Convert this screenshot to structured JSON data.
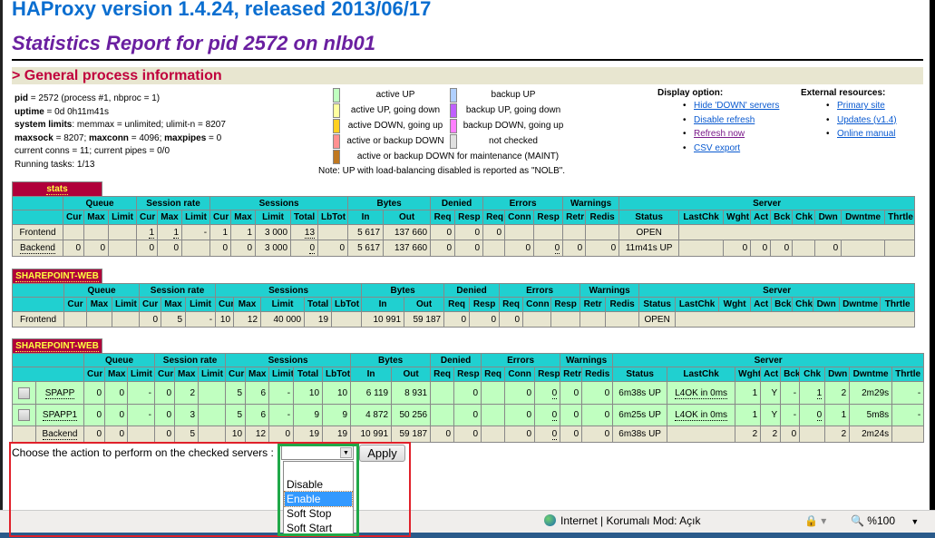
{
  "header": {
    "version_title": "HAProxy version 1.4.24, released 2013/06/17",
    "report_title": "Statistics Report for pid 2572 on nlb01",
    "section_title": "> General process information"
  },
  "process_info": {
    "pid_label": "pid",
    "pid_value": " = 2572 (process #1, nbproc = 1)",
    "uptime_label": "uptime",
    "uptime_value": " = 0d 0h11m41s",
    "limits_label": "system limits",
    "limits_value": ": memmax = unlimited; ulimit-n = 8207",
    "maxsock_label": "maxsock",
    "maxsock_value": " = 8207; ",
    "maxconn_label": "maxconn",
    "maxconn_value": " = 4096; ",
    "maxpipes_label": "maxpipes",
    "maxpipes_value": " = 0",
    "conns": "current conns = 11; current pipes = 0/0",
    "tasks": "Running tasks: 1/13"
  },
  "legend": {
    "items": [
      {
        "label": "active UP",
        "color": "#c0ffc0"
      },
      {
        "label": "backup UP",
        "color": "#b0d0ff"
      },
      {
        "label": "active UP, going down",
        "color": "#ffffa0"
      },
      {
        "label": "backup UP, going down",
        "color": "#c060ff"
      },
      {
        "label": "active DOWN, going up",
        "color": "#ffd020"
      },
      {
        "label": "backup DOWN, going up",
        "color": "#ff80ff"
      },
      {
        "label": "active or backup DOWN",
        "color": "#ff9090"
      },
      {
        "label": "not checked",
        "color": "#e0e0e0"
      },
      {
        "label": "active or backup DOWN for maintenance (MAINT)",
        "color": "#c07820"
      }
    ],
    "note": "Note: UP with load-balancing disabled is reported as \"NOLB\"."
  },
  "display_options": {
    "title": "Display option:",
    "items": [
      "Hide 'DOWN' servers",
      "Disable refresh",
      "Refresh now",
      "CSV export"
    ]
  },
  "external_resources": {
    "title": "External resources:",
    "items": [
      "Primary site",
      "Updates (v1.4)",
      "Online manual"
    ]
  },
  "colors": {
    "header_bg": "#20d0d0",
    "frontend_bg": "#e8e6d0",
    "server_up_bg": "#c0ffc0",
    "proxy_tab_bg": "#b0003a",
    "proxy_tab_text": "#ffff40"
  },
  "groups": [
    {
      "label": "Queue",
      "span": 3
    },
    {
      "label": "Session rate",
      "span": 3
    },
    {
      "label": "Sessions",
      "span": 5
    },
    {
      "label": "Bytes",
      "span": 2
    },
    {
      "label": "Denied",
      "span": 2
    },
    {
      "label": "Errors",
      "span": 3
    },
    {
      "label": "Warnings",
      "span": 2
    },
    {
      "label": "Server",
      "span": 9
    }
  ],
  "columns": [
    "Cur",
    "Max",
    "Limit",
    "Cur",
    "Max",
    "Limit",
    "Cur",
    "Max",
    "Limit",
    "Total",
    "LbTot",
    "In",
    "Out",
    "Req",
    "Resp",
    "Req",
    "Conn",
    "Resp",
    "Retr",
    "Redis",
    "Status",
    "LastChk",
    "Wght",
    "Act",
    "Bck",
    "Chk",
    "Dwn",
    "Dwntme",
    "Thrtle"
  ],
  "proxies": [
    {
      "name": "stats",
      "rows": [
        {
          "type": "frontend",
          "name": "Frontend",
          "cells": [
            "",
            "",
            "",
            "1",
            "1",
            "-",
            "1",
            "1",
            "3 000",
            "13",
            "",
            "5 617",
            "137 660",
            "0",
            "0",
            "0",
            "",
            "",
            "",
            "",
            "OPEN"
          ],
          "underlined": [
            3,
            4,
            9
          ]
        },
        {
          "type": "backend",
          "name": "Backend",
          "cells": [
            "0",
            "0",
            "",
            "0",
            "0",
            "",
            "0",
            "0",
            "3 000",
            "0",
            "0",
            "5 617",
            "137 660",
            "0",
            "0",
            "",
            "0",
            "0",
            "0",
            "0",
            "11m41s UP",
            "",
            "0",
            "0",
            "0",
            "",
            "0",
            "",
            ""
          ],
          "underlined": [
            9,
            17
          ]
        }
      ]
    },
    {
      "name": "SHAREPOINT-WEB",
      "rows": [
        {
          "type": "frontend",
          "name": "Frontend",
          "cells": [
            "",
            "",
            "",
            "0",
            "5",
            "-",
            "10",
            "12",
            "40 000",
            "19",
            "",
            "10 991",
            "59 187",
            "0",
            "0",
            "0",
            "",
            "",
            "",
            "",
            "OPEN"
          ],
          "underlined": []
        }
      ]
    },
    {
      "name": "SHAREPOINT-WEB",
      "checkbox_column": true,
      "rows": [
        {
          "type": "server",
          "name": "SPAPP",
          "checked": false,
          "cells": [
            "0",
            "0",
            "-",
            "0",
            "2",
            "",
            "5",
            "6",
            "-",
            "10",
            "10",
            "6 119",
            "8 931",
            "",
            "0",
            "",
            "0",
            "0",
            "0",
            "0",
            "6m38s UP",
            "L4OK in 0ms",
            "1",
            "Y",
            "-",
            "1",
            "2",
            "2m29s",
            "-"
          ],
          "underlined": [
            17,
            21,
            25
          ]
        },
        {
          "type": "server",
          "name": "SPAPP1",
          "checked": false,
          "cells": [
            "0",
            "0",
            "-",
            "0",
            "3",
            "",
            "5",
            "6",
            "-",
            "9",
            "9",
            "4 872",
            "50 256",
            "",
            "0",
            "",
            "0",
            "0",
            "0",
            "0",
            "6m25s UP",
            "L4OK in 0ms",
            "1",
            "Y",
            "-",
            "0",
            "1",
            "5m8s",
            "-"
          ],
          "underlined": [
            17,
            21,
            25
          ]
        },
        {
          "type": "backend",
          "name": "Backend",
          "cells": [
            "0",
            "0",
            "",
            "0",
            "5",
            "",
            "10",
            "12",
            "0",
            "19",
            "19",
            "10 991",
            "59 187",
            "0",
            "0",
            "",
            "0",
            "0",
            "0",
            "0",
            "6m38s UP",
            "",
            "2",
            "2",
            "0",
            "",
            "2",
            "2m24s",
            ""
          ],
          "underlined": [
            17
          ]
        }
      ]
    }
  ],
  "action": {
    "label": "Choose the action to perform on the checked servers :",
    "selected": "",
    "options": [
      "",
      "Disable",
      "Enable",
      "Soft Stop",
      "Soft Start"
    ],
    "highlighted": "Enable",
    "apply_label": "Apply"
  },
  "statusbar": {
    "zone": "Internet | Korumalı Mod: Açık",
    "zoom": "%100"
  }
}
